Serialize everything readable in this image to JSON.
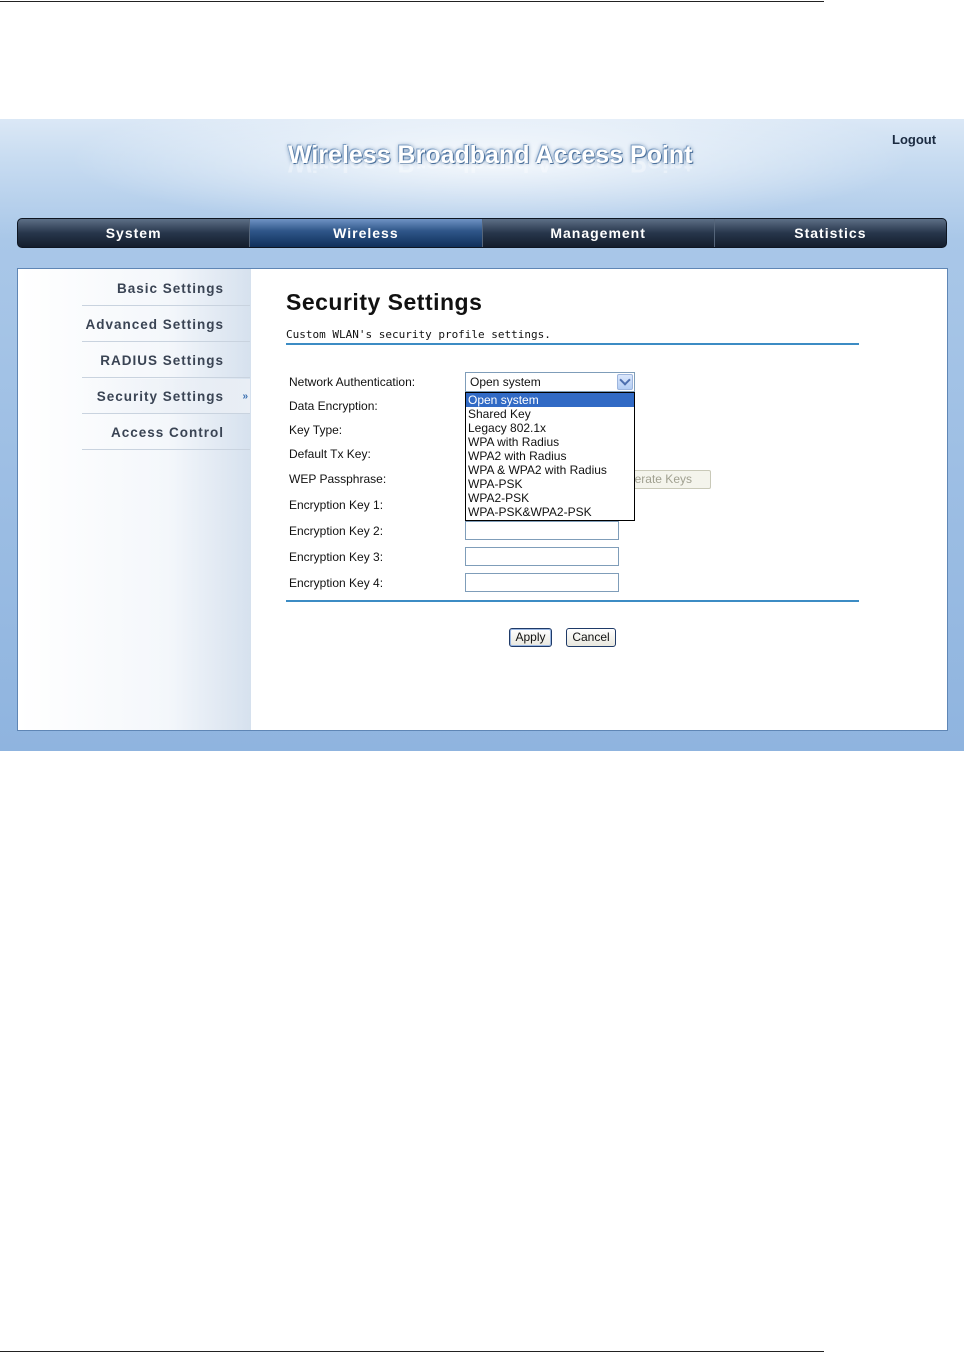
{
  "header": {
    "title": "Wireless Broadband Access Point",
    "logout_label": "Logout"
  },
  "nav": {
    "tabs": [
      {
        "label": "System"
      },
      {
        "label": "Wireless"
      },
      {
        "label": "Management"
      },
      {
        "label": "Statistics"
      }
    ],
    "active": "Wireless"
  },
  "sidebar": {
    "items": [
      {
        "label": "Basic Settings"
      },
      {
        "label": "Advanced Settings"
      },
      {
        "label": "RADIUS Settings"
      },
      {
        "label": "Security Settings"
      },
      {
        "label": "Access Control"
      }
    ],
    "active_arrow": "»"
  },
  "main": {
    "title": "Security Settings",
    "subtitle": "Custom WLAN's security profile settings.",
    "labels": {
      "network_auth": "Network Authentication:",
      "data_encryption": "Data Encryption:",
      "key_type": "Key Type:",
      "default_tx_key": "Default Tx Key:",
      "wep_passphrase": "WEP Passphrase:",
      "enc_key_1": "Encryption Key 1:",
      "enc_key_2": "Encryption Key 2:",
      "enc_key_3": "Encryption Key 3:",
      "enc_key_4": "Encryption Key 4:"
    },
    "network_auth_select": {
      "value": "Open system",
      "options": [
        "Open system",
        "Shared Key",
        "Legacy 802.1x",
        "WPA with Radius",
        "WPA2 with Radius",
        "WPA & WPA2 with Radius",
        "WPA-PSK",
        "WPA2-PSK",
        "WPA-PSK&WPA2-PSK"
      ]
    },
    "generate_keys_label_visible": "erate Keys",
    "apply_label": "Apply",
    "cancel_label": "Cancel"
  },
  "colors": {
    "accent_rule": "#3c8cc4",
    "selected_option": "#316ac5",
    "nav_active": "#2f5689"
  }
}
